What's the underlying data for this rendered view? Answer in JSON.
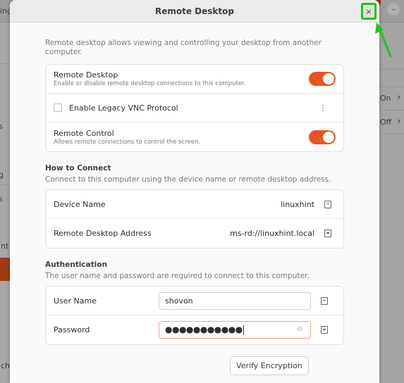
{
  "background": {
    "header_text": "ing",
    "sidebar_fragments": [
      "s",
      "g",
      "s",
      "unt",
      "uch"
    ],
    "right_values": [
      {
        "label": "On"
      },
      {
        "label": "Off"
      }
    ],
    "chevron": "›",
    "minimize": "–"
  },
  "dialog": {
    "title": "Remote Desktop",
    "close_icon": "×",
    "intro": "Remote desktop allows viewing and controlling your desktop from another computer.",
    "general": {
      "remote_desktop": {
        "title": "Remote Desktop",
        "subtitle": "Enable or disable remote desktop connections to this computer.",
        "enabled": true
      },
      "legacy_vnc": {
        "label": "Enable Legacy VNC Protocol",
        "checked": false,
        "menu_icon": "⋮"
      },
      "remote_control": {
        "title": "Remote Control",
        "subtitle": "Allows remote connections to control the screen.",
        "enabled": true
      }
    },
    "how_to_connect": {
      "heading": "How to Connect",
      "description": "Connect to this computer using the device name or remote desktop address.",
      "rows": [
        {
          "label": "Device Name",
          "value": "linuxhint"
        },
        {
          "label": "Remote Desktop Address",
          "value": "ms-rd://linuxhint.local"
        }
      ]
    },
    "authentication": {
      "heading": "Authentication",
      "description": "The user name and password are required to connect to this computer.",
      "username_label": "User Name",
      "username_value": "shovon",
      "password_label": "Password",
      "password_masked": "●●●●●●●●●●●",
      "eye_icon": "⊘"
    },
    "verify_button": "Verify Encryption"
  },
  "colors": {
    "accent": "#e95420",
    "highlight": "#22c51d"
  }
}
